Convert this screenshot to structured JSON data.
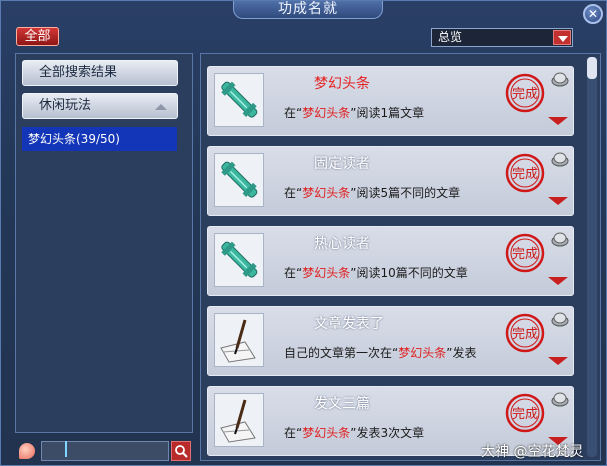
{
  "window": {
    "title": "功成名就",
    "close_label": "✕"
  },
  "toolbar": {
    "all_label": "全部",
    "filter_value": "总览"
  },
  "sidebar": {
    "items": [
      {
        "label": "全部搜索结果"
      },
      {
        "label": "休闲玩法"
      }
    ],
    "selected_sub": "梦幻头条(39/50)"
  },
  "search": {
    "placeholder": "",
    "button_icon": "search-icon"
  },
  "achievements": [
    {
      "name": "梦幻头条",
      "desc_pre": "在“",
      "highlight": "梦幻头条",
      "desc_post": "”阅读1篇文章",
      "icon": "scroll-icon",
      "completed": true
    },
    {
      "name": "固定读者",
      "desc_pre": "在“",
      "highlight": "梦幻头条",
      "desc_post": "”阅读5篇不同的文章",
      "icon": "scroll-icon",
      "completed": true
    },
    {
      "name": "热心读者",
      "desc_pre": "在“",
      "highlight": "梦幻头条",
      "desc_post": "”阅读10篇不同的文章",
      "icon": "scroll-icon",
      "completed": true
    },
    {
      "name": "文章发表了",
      "desc_pre": "自己的文章第一次在“",
      "highlight": "梦幻头条",
      "desc_post": "”发表",
      "icon": "quill-paper-icon",
      "completed": true
    },
    {
      "name": "发文三篇",
      "desc_pre": "在“",
      "highlight": "梦幻头条",
      "desc_post": "”发表3次文章",
      "icon": "quill-paper-icon",
      "completed": true
    }
  ],
  "stamp_text": "完成",
  "watermark": "大神 @空花梵灵",
  "colors": {
    "accent_red": "#e02020",
    "selected_blue": "#1335b7"
  }
}
